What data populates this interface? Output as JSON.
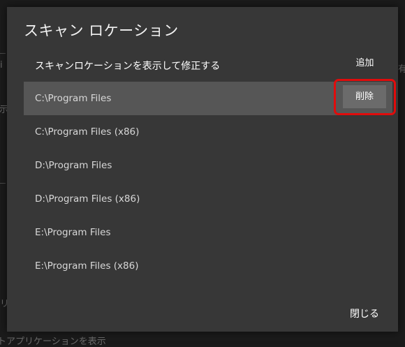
{
  "background": {
    "fragments": [
      "i",
      "有",
      "表示",
      "リ",
      "トアプリケーションを表示"
    ]
  },
  "dialog": {
    "title": "スキャン ロケーション",
    "subheader": "スキャンロケーションを表示して修正する",
    "add_label": "追加",
    "delete_label": "削除",
    "close_label": "閉じる",
    "locations": [
      "C:\\Program Files",
      "C:\\Program Files (x86)",
      "D:\\Program Files",
      "D:\\Program Files (x86)",
      "E:\\Program Files",
      "E:\\Program Files (x86)"
    ],
    "selected_index": 0
  },
  "colors": {
    "dialog_bg": "#373737",
    "selected_row": "#565656",
    "highlight_border": "#e00c0c",
    "delete_button_bg": "#6b6b6b"
  }
}
